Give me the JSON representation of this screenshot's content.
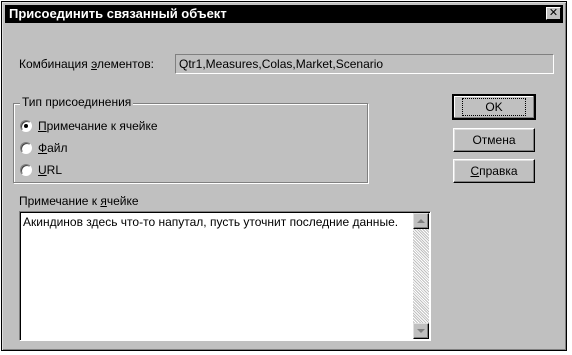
{
  "dialog": {
    "title": "Присоединить связанный объект",
    "close_glyph": "✕"
  },
  "combination": {
    "label_before": "Комбинация ",
    "label_hotkey": "э",
    "label_after": "лементов:",
    "value": "Qtr1,Measures,Colas,Market,Scenario"
  },
  "attach_type": {
    "legend": "Тип присоединения",
    "options": [
      {
        "hotkey": "П",
        "rest": "римечание к ячейке",
        "checked": true
      },
      {
        "hotkey": "Ф",
        "rest": "айл",
        "checked": false
      },
      {
        "hotkey": "U",
        "rest": "RL",
        "checked": false
      }
    ]
  },
  "note": {
    "label_before": "Примечание к ",
    "label_hotkey": "я",
    "label_after": "чейке",
    "text": "Акиндинов здесь что-то напутал, пусть уточнит последние данные."
  },
  "buttons": {
    "ok": "OK",
    "cancel": "Отмена",
    "help_hotkey": "С",
    "help_rest": "правка"
  }
}
